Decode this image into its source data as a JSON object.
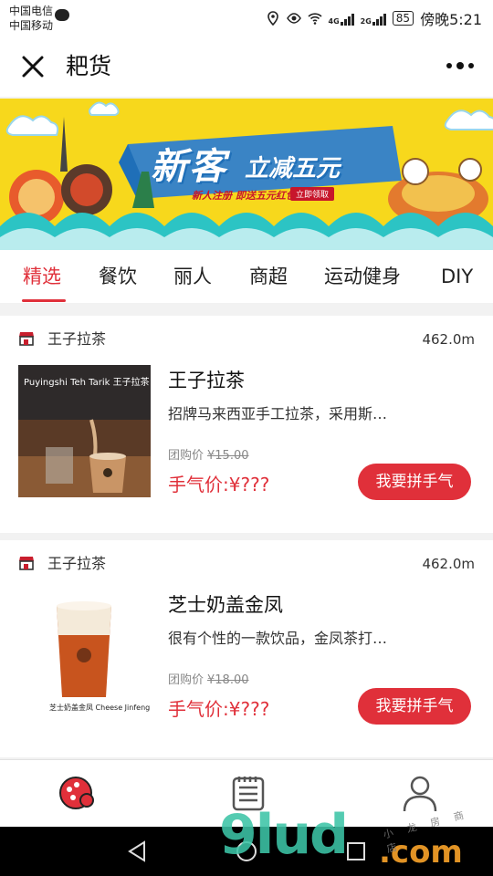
{
  "status_bar": {
    "carrier_1": "中国电信",
    "carrier_2": "中国移动",
    "network_1": "4G",
    "network_2": "2G",
    "battery": "85",
    "time": "傍晚5:21"
  },
  "title_bar": {
    "title": "耙货"
  },
  "banner": {
    "headline": "新客",
    "subheadline": "立减五元",
    "promo_text": "新人注册 即送五元红包",
    "cta": "立即领取",
    "colors": {
      "background": "#f7d81c",
      "wave": "#2cc4c4",
      "stroke": "#1f6fb8"
    }
  },
  "tabs": [
    {
      "label": "精选",
      "active": true
    },
    {
      "label": "餐饮",
      "active": false
    },
    {
      "label": "丽人",
      "active": false
    },
    {
      "label": "商超",
      "active": false
    },
    {
      "label": "运动健身",
      "active": false
    },
    {
      "label": "DIY",
      "active": false
    }
  ],
  "cards": [
    {
      "shop_name": "王子拉茶",
      "distance": "462.0m",
      "item_name": "王子拉茶",
      "description": "招牌马来西亚手工拉茶，采用斯…",
      "group_price_label": "团购价",
      "group_price": "¥15.00",
      "price_label": "手气价:",
      "price": "¥???",
      "button": "我要拼手气",
      "image_text": "Puyingshi Teh Tarik 王子拉茶"
    },
    {
      "shop_name": "王子拉茶",
      "distance": "462.0m",
      "item_name": "芝士奶盖金凤",
      "description": "很有个性的一款饮品，金凤茶打…",
      "group_price_label": "团购价",
      "group_price": "¥18.00",
      "price_label": "手气价:",
      "price": "¥???",
      "button": "我要拼手气",
      "image_text": "芝士奶盖金凤 Cheese Jinfeng Tea"
    }
  ],
  "bottom_nav": [
    {
      "icon": "home-icon",
      "active": true
    },
    {
      "icon": "orders-icon",
      "active": false
    },
    {
      "icon": "profile-icon",
      "active": false
    }
  ],
  "watermark": {
    "main": "9lud",
    "domain": ".com",
    "small": "小 龙 房 商 店"
  },
  "colors": {
    "accent": "#e0303a",
    "text": "#222222",
    "muted": "#888888"
  }
}
